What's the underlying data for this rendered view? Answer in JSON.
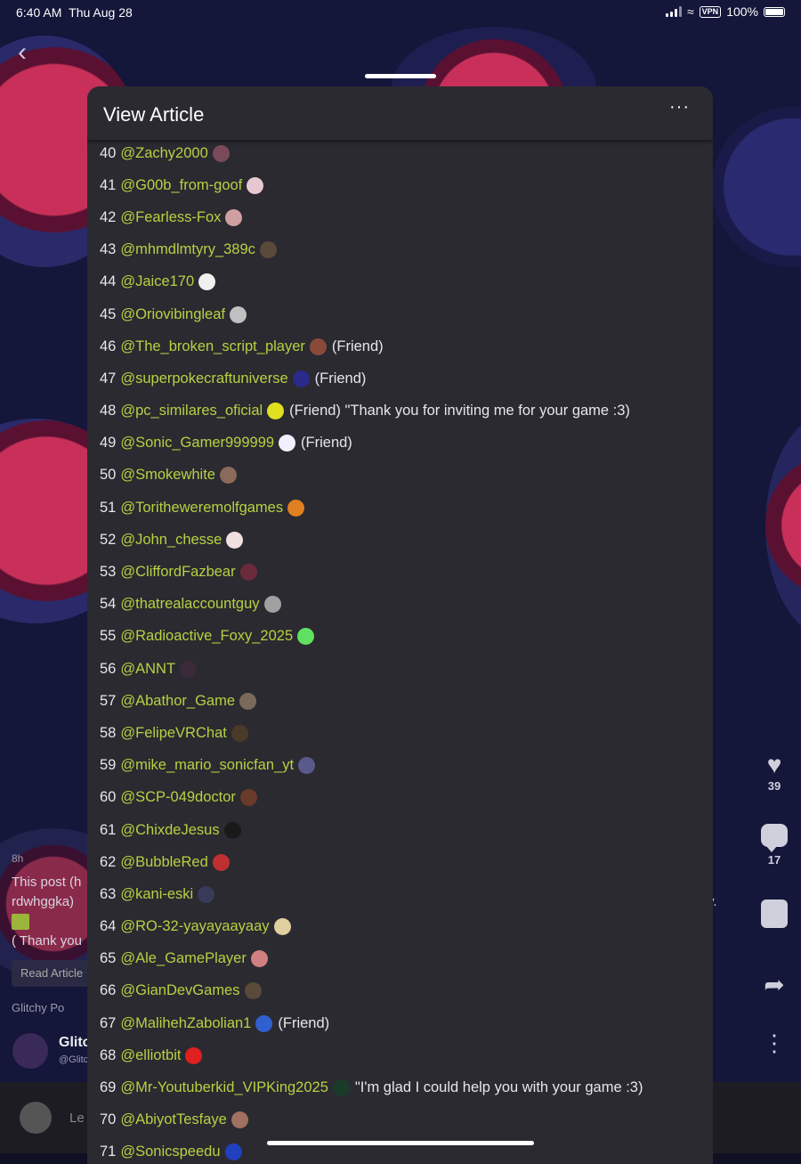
{
  "status_bar": {
    "time": "6:40 AM",
    "date": "Thu Aug 28",
    "vpn": "VPN",
    "battery": "100%"
  },
  "sheet": {
    "title": "View Article",
    "more": "···"
  },
  "underlying": {
    "time": "8h",
    "line1": "This post (h",
    "line2": "rdwhggka)",
    "line3": "( Thank you",
    "read_btn": "Read Article",
    "tag": "Glitchy Po",
    "author": "Glitc",
    "handle": "@Glitc",
    "right_frag": "ry.",
    "comment_placeholder": "Le"
  },
  "rail": {
    "likes": "39",
    "comments": "17"
  },
  "icons": [
    "back-chevron-icon",
    "heart-icon",
    "comment-icon",
    "sticker-icon",
    "share-icon",
    "more-vertical-icon",
    "wifi-icon",
    "signal-icon",
    "battery-icon"
  ],
  "rows": [
    {
      "n": "40",
      "user": "@Zachy2000",
      "color": "#7a4a5a",
      "note": ""
    },
    {
      "n": "41",
      "user": "@G00b_from-goof",
      "color": "#e8c8d0",
      "note": ""
    },
    {
      "n": "42",
      "user": "@Fearless-Fox",
      "color": "#d0a0a0",
      "note": ""
    },
    {
      "n": "43",
      "user": "@mhmdlmtyry_389c",
      "color": "#5a4a3a",
      "note": ""
    },
    {
      "n": "44",
      "user": "@Jaice170",
      "color": "#f0f0f0",
      "note": ""
    },
    {
      "n": "45",
      "user": "@Oriovibingleaf",
      "color": "#c0c0c0",
      "note": ""
    },
    {
      "n": "46",
      "user": "@The_broken_script_player",
      "color": "#8a4a3a",
      "note": "(Friend)"
    },
    {
      "n": "47",
      "user": "@superpokecraftuniverse",
      "color": "#2a2a8a",
      "note": "(Friend)"
    },
    {
      "n": "48",
      "user": "@pc_similares_oficial",
      "color": "#e0e020",
      "note": "(Friend) \"Thank you for inviting me for your game :3)"
    },
    {
      "n": "49",
      "user": "@Sonic_Gamer999999",
      "color": "#f0f0ff",
      "note": "(Friend)"
    },
    {
      "n": "50",
      "user": "@Smokewhite",
      "color": "#8a6a5a",
      "note": ""
    },
    {
      "n": "51",
      "user": "@Toritheweremolfgames",
      "color": "#e08020",
      "note": ""
    },
    {
      "n": "52",
      "user": "@John_chesse",
      "color": "#f0e0e0",
      "note": ""
    },
    {
      "n": "53",
      "user": "@CliffordFazbear",
      "color": "#6a2a3a",
      "note": ""
    },
    {
      "n": "54",
      "user": "@thatrealaccountguy",
      "color": "#a0a0a0",
      "note": ""
    },
    {
      "n": "55",
      "user": "@Radioactive_Foxy_2025",
      "color": "#60e060",
      "note": ""
    },
    {
      "n": "56",
      "user": "@ANNT",
      "color": "#3a2a3a",
      "note": ""
    },
    {
      "n": "57",
      "user": "@Abathor_Game",
      "color": "#7a6a5a",
      "note": ""
    },
    {
      "n": "58",
      "user": "@FelipeVRChat",
      "color": "#4a3a2a",
      "note": ""
    },
    {
      "n": "59",
      "user": "@mike_mario_sonicfan_yt",
      "color": "#5a5a8a",
      "note": ""
    },
    {
      "n": "60",
      "user": "@SCP-049doctor",
      "color": "#6a3a2a",
      "note": ""
    },
    {
      "n": "61",
      "user": "@ChixdeJesus",
      "color": "#1a1a1a",
      "note": ""
    },
    {
      "n": "62",
      "user": "@BubbleRed",
      "color": "#c03030",
      "note": ""
    },
    {
      "n": "63",
      "user": "@kani-eski",
      "color": "#3a3a5a",
      "note": ""
    },
    {
      "n": "64",
      "user": "@RO-32-yayayaayaay",
      "color": "#e0d0a0",
      "note": ""
    },
    {
      "n": "65",
      "user": "@Ale_GamePlayer",
      "color": "#d08080",
      "note": ""
    },
    {
      "n": "66",
      "user": "@GianDevGames",
      "color": "#5a4a3a",
      "note": ""
    },
    {
      "n": "67",
      "user": "@MalihehZabolian1",
      "color": "#3060d0",
      "note": "(Friend)"
    },
    {
      "n": "68",
      "user": "@elliotbit",
      "color": "#e02020",
      "note": ""
    },
    {
      "n": "69",
      "user": "@Mr-Youtuberkid_VIPKing2025",
      "color": "#1a3a2a",
      "note": "\"I'm glad I could help you with your game :3)"
    },
    {
      "n": "70",
      "user": "@AbiyotTesfaye",
      "color": "#a07060",
      "note": ""
    },
    {
      "n": "71",
      "user": "@Sonicspeedu",
      "color": "#2040c0",
      "note": ""
    }
  ]
}
